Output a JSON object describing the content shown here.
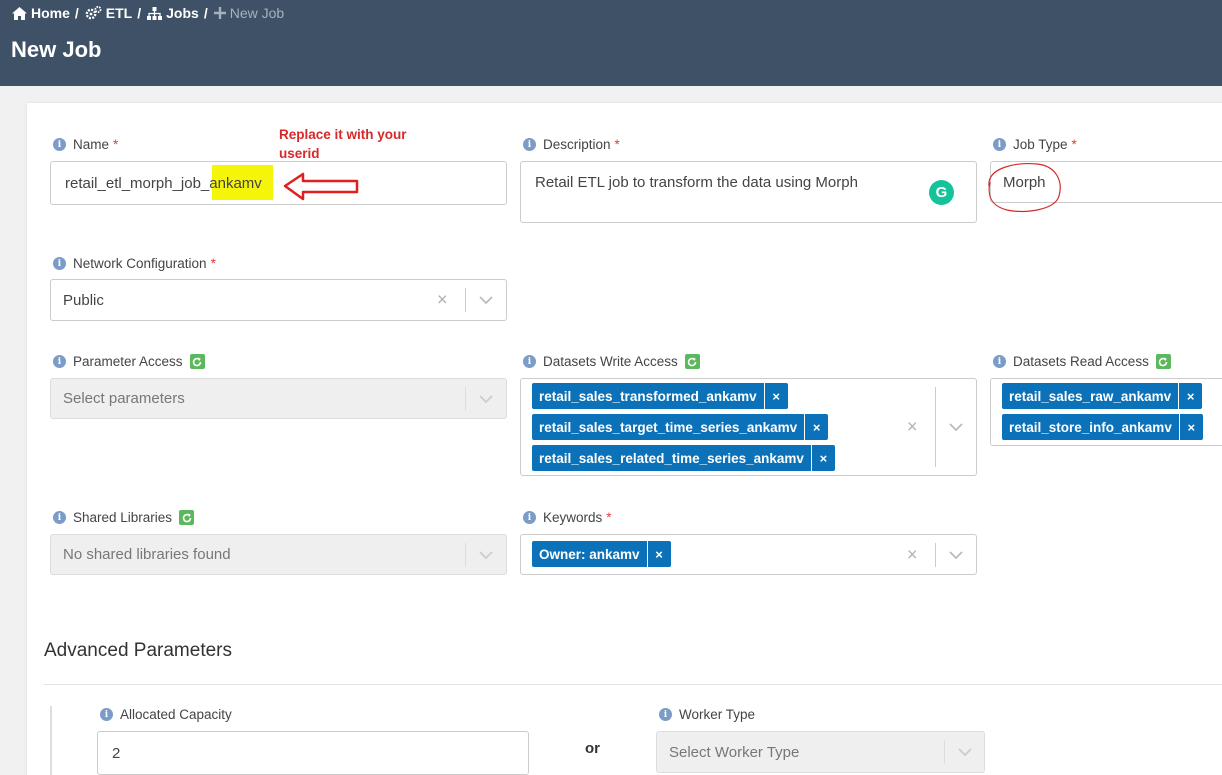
{
  "breadcrumb": {
    "home": "Home",
    "etl": "ETL",
    "jobs": "Jobs",
    "current": "New Job",
    "separator": "/"
  },
  "page": {
    "title": "New Job"
  },
  "required_marker": "*",
  "annotation": {
    "note": "Replace it with your userid"
  },
  "form": {
    "name": {
      "label": "Name",
      "value": "retail_etl_morph_job_ankamv"
    },
    "description": {
      "label": "Description",
      "value": "Retail ETL job to transform the data using Morph"
    },
    "job_type": {
      "label": "Job Type",
      "value": "Morph"
    },
    "network_configuration": {
      "label": "Network Configuration",
      "value": "Public"
    },
    "parameter_access": {
      "label": "Parameter Access",
      "placeholder": "Select parameters"
    },
    "datasets_write_access": {
      "label": "Datasets Write Access",
      "tags": [
        "retail_sales_transformed_ankamv",
        "retail_sales_target_time_series_ankamv",
        "retail_sales_related_time_series_ankamv"
      ]
    },
    "datasets_read_access": {
      "label": "Datasets Read Access",
      "tags": [
        "retail_sales_raw_ankamv",
        "retail_store_info_ankamv"
      ]
    },
    "shared_libraries": {
      "label": "Shared Libraries",
      "placeholder": "No shared libraries found"
    },
    "keywords": {
      "label": "Keywords",
      "tags": [
        "Owner: ankamv"
      ]
    }
  },
  "advanced": {
    "title": "Advanced Parameters",
    "allocated_capacity": {
      "label": "Allocated Capacity",
      "value": "2"
    },
    "or_text": "or",
    "worker_type": {
      "label": "Worker Type",
      "placeholder": "Select Worker Type"
    }
  },
  "icons": {
    "info": "i",
    "tag_remove": "×",
    "clear": "×",
    "grammarly": "G"
  },
  "colors": {
    "header_bg": "#3f5166",
    "tag_bg": "#0b72b9",
    "refresh_green": "#5cb85c",
    "required_red": "#e53935",
    "annotation_red": "#d62929",
    "highlight_yellow": "#f5f50a",
    "grammarly_green": "#15c39a"
  }
}
